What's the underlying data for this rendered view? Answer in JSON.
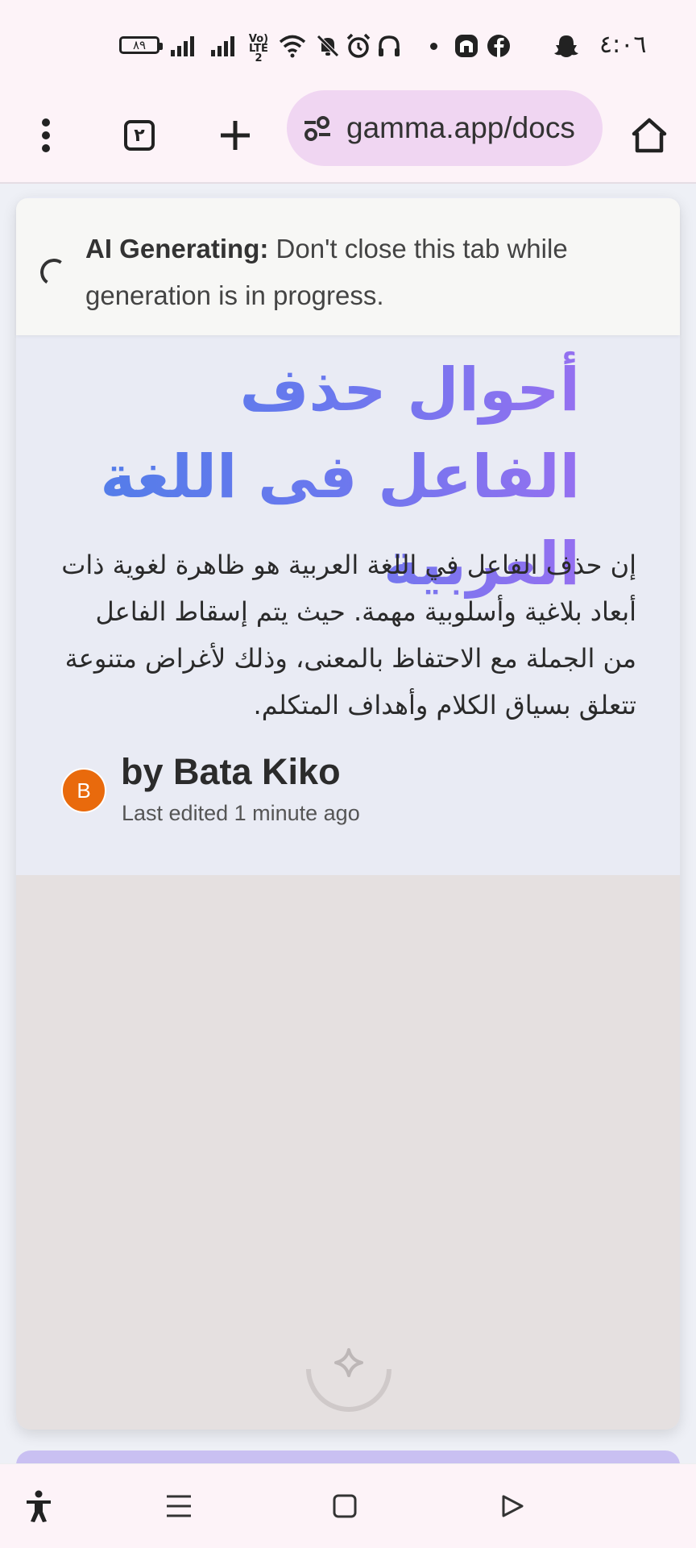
{
  "status_bar": {
    "battery": "٨٩",
    "volte": "Vo) LTE2",
    "time": "٤:٠٦"
  },
  "browser": {
    "tab_count": "٢",
    "url": "gamma.app/docs"
  },
  "banner": {
    "label": "AI Generating:",
    "message": " Don't close this tab while generation is in progress."
  },
  "doc": {
    "title": "أحوال حذف الفاعل فى اللغة العربية",
    "description": "إن حذف الفاعل في اللغة العربية هو ظاهرة لغوية ذات أبعاد بلاغية وأسلوبية مهمة. حيث يتم إسقاط الفاعل من الجملة مع الاحتفاظ بالمعنى، وذلك لأغراض متنوعة تتعلق بسياق الكلام وأهداف المتكلم.",
    "avatar_initial": "B",
    "author": "by Bata Kiko",
    "edited": "Last edited 1 minute ago"
  },
  "colors": {
    "title_gradient_start": "#4f7ee8",
    "title_gradient_end": "#9a6ff0",
    "avatar": "#e96a0c",
    "url_bar": "#f0d6f2"
  },
  "icons": [
    "more-vert-icon",
    "new-tab-icon",
    "site-settings-icon",
    "home-icon",
    "loading-spinner-icon",
    "sparkle-icon",
    "accessibility-icon",
    "recents-icon",
    "home-nav-icon",
    "back-nav-icon"
  ]
}
